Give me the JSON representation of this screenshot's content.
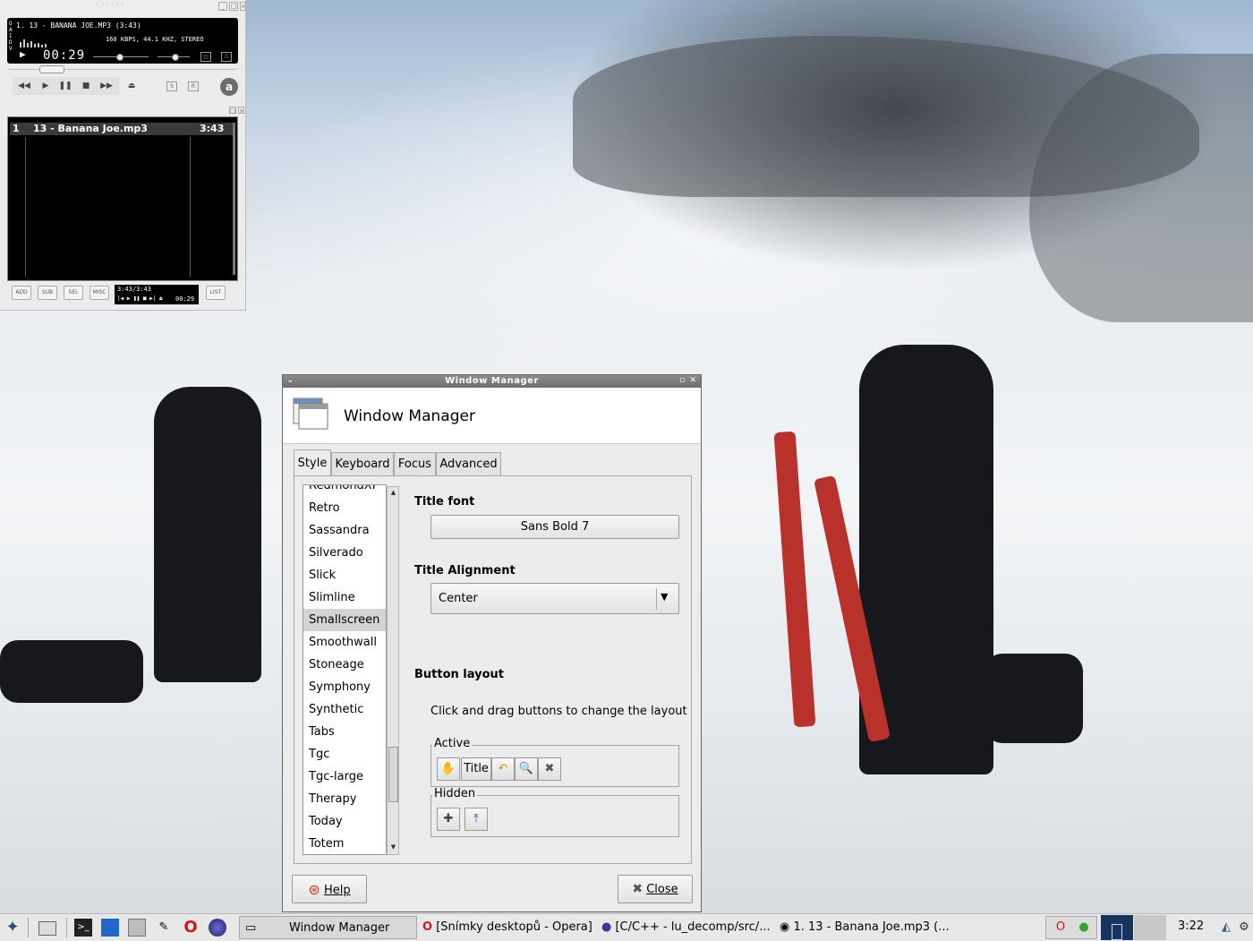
{
  "player": {
    "track_title": "1. 13 - BANANA JOE.MP3 (3:43)",
    "stream_info": "160 KBPS, 44.1 KHZ, STEREO",
    "elapsed": "00:29",
    "playlist": {
      "index": "1",
      "title": "13 - Banana Joe.mp3",
      "duration": "3:43"
    },
    "buttons": {
      "add": "ADD",
      "sub": "SUB",
      "sel": "SEL",
      "misc": "MISC",
      "list": "LIST",
      "s": "S",
      "r": "R"
    },
    "mini_total": "3:43/3:43",
    "mini_elapsed": "00:29"
  },
  "wm": {
    "window_title": "Window Manager",
    "header_title": "Window Manager",
    "tabs": [
      "Style",
      "Keyboard",
      "Focus",
      "Advanced"
    ],
    "active_tab": "Style",
    "themes": [
      "RedmondXP",
      "Retro",
      "Sassandra",
      "Silverado",
      "Slick",
      "Slimline",
      "Smallscreen",
      "Smoothwall",
      "Stoneage",
      "Symphony",
      "Synthetic",
      "Tabs",
      "Tgc",
      "Tgc-large",
      "Therapy",
      "Today",
      "Totem"
    ],
    "selected_theme": "Smallscreen",
    "title_font_label": "Title font",
    "title_font_value": "Sans Bold 7",
    "title_alignment_label": "Title Alignment",
    "title_alignment_value": "Center",
    "button_layout_label": "Button layout",
    "button_layout_hint": "Click and drag buttons to change the layout",
    "active_label": "Active",
    "hidden_label": "Hidden",
    "active_title_btn": "Title",
    "help_btn": "Help",
    "close_btn": "Close"
  },
  "taskbar": {
    "tasks": [
      "Window Manager",
      "[Snímky desktopů - Opera]",
      "[C/C++ - lu_decomp/src/...",
      "1. 13 - Banana Joe.mp3 (..."
    ],
    "clock": "3:22"
  }
}
